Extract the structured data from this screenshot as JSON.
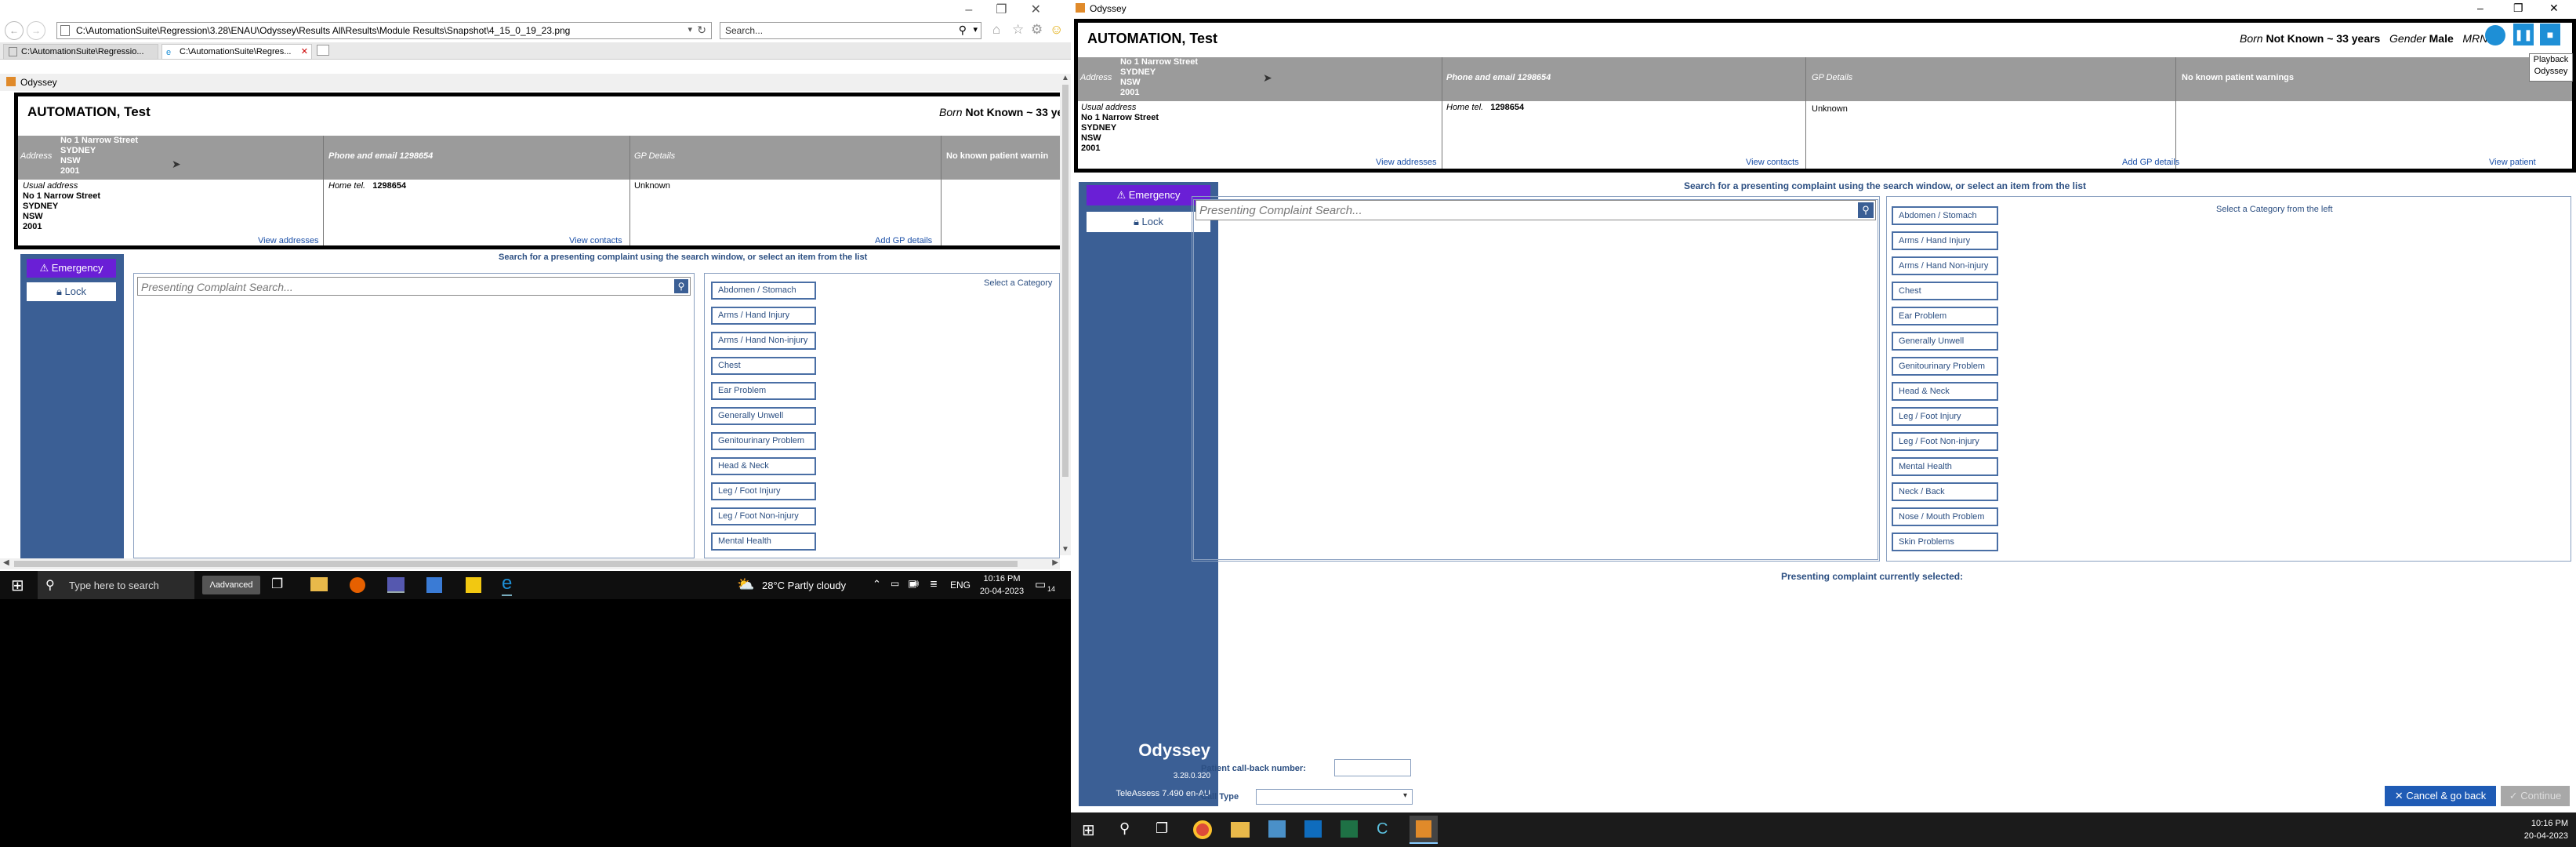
{
  "ie": {
    "address_url": "C:\\AutomationSuite\\Regression\\3.28\\ENAU\\Odyssey\\Results All\\Results\\Module Results\\Snapshot\\4_15_0_19_23.png",
    "search_placeholder": "Search...",
    "tabs": [
      "C:\\AutomationSuite\\Regressio...",
      "C:\\AutomationSuite\\Regres..."
    ],
    "window_title": "Odyssey"
  },
  "patient": {
    "name": "AUTOMATION, Test",
    "born_label": "Born",
    "born_value": "Not Known ~ 33 years",
    "born_value_short": "Not Known ~ 33 ye",
    "gender_label": "Gender",
    "gender_value": "Male",
    "mrn_label": "MRN",
    "address_label": "Address",
    "address_lines": [
      "No 1 Narrow Street",
      "SYDNEY",
      "NSW",
      "2001"
    ],
    "phone_header": "Phone and email  1298654",
    "gp_header": "GP Details",
    "warnings_header": "No known patient warnings",
    "warnings_header_short": "No known patient warnin",
    "usual_address_label": "Usual address",
    "home_tel_label": "Home tel.",
    "home_tel_value": "1298654",
    "gp_value": "Unknown",
    "view_addresses": "View addresses",
    "view_contacts": "View contacts",
    "add_gp": "Add GP details",
    "view_warnings": "View patient warnings"
  },
  "sidebar": {
    "emergency": "Emergency",
    "lock": "Lock",
    "brand": "Odyssey",
    "version": "3.28.0.320",
    "teleassess": "TeleAssess 7.490 en-AU"
  },
  "complaint": {
    "instruction": "Search for a presenting complaint using the search window, or select an item from the list",
    "search_placeholder": "Presenting Complaint Search...",
    "select_hint": "Select a Category from the left",
    "select_hint_short": "Select a Category",
    "categories": [
      "Abdomen / Stomach",
      "Arms / Hand Injury",
      "Arms / Hand Non-injury",
      "Chest",
      "Ear Problem",
      "Generally Unwell",
      "Genitourinary Problem",
      "Head & Neck",
      "Leg / Foot Injury",
      "Leg / Foot Non-injury",
      "Mental Health",
      "Neck / Back",
      "Nose / Mouth Problem",
      "Skin Problems"
    ],
    "current_selected_label": "Presenting complaint currently selected:",
    "callback_label": "Patient call-back number:",
    "calltype_label": "Call Type",
    "cancel_button": "Cancel & go back",
    "continue_button": "Continue"
  },
  "playback": {
    "line1": "Playback",
    "line2": "Odyssey"
  },
  "taskbar_left": {
    "search_placeholder": "Type here to search",
    "advanced_label": "advanced",
    "weather": "28°C  Partly cloudy",
    "lang": "ENG",
    "time": "10:16 PM",
    "date": "20-04-2023",
    "notif_count": "14"
  },
  "taskbar_right": {
    "time": "10:16 PM",
    "date": "20-04-2023"
  },
  "colors": {
    "accent_navy": "#3b5f95",
    "emergency_purple": "#6a1fd6",
    "link_blue": "#1a4fa8",
    "header_gray": "#9b9b9b"
  }
}
